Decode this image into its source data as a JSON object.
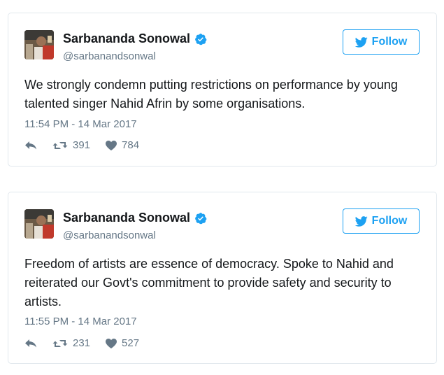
{
  "tweets": [
    {
      "name": "Sarbananda Sonowal",
      "handle": "@sarbanandsonwal",
      "follow_label": "Follow",
      "text": "We strongly condemn putting restrictions on performance by young talented singer Nahid Afrin by some organisations.",
      "timestamp": "11:54 PM - 14 Mar 2017",
      "retweets": "391",
      "likes": "784"
    },
    {
      "name": "Sarbananda Sonowal",
      "handle": "@sarbanandsonwal",
      "follow_label": "Follow",
      "text": "Freedom of artists are essence of democracy. Spoke to Nahid and reiterated our Govt's commitment to provide safety and security to artists.",
      "timestamp": "11:55 PM - 14 Mar 2017",
      "retweets": "231",
      "likes": "527"
    }
  ],
  "icons": {
    "verified": "verified-badge-icon",
    "follow": "twitter-bird-icon",
    "reply": "reply-icon",
    "retweet": "retweet-icon",
    "like": "heart-icon"
  },
  "colors": {
    "accent": "#1da1f2",
    "muted": "#657786",
    "text": "#14171a",
    "border": "#e1e8ed"
  }
}
